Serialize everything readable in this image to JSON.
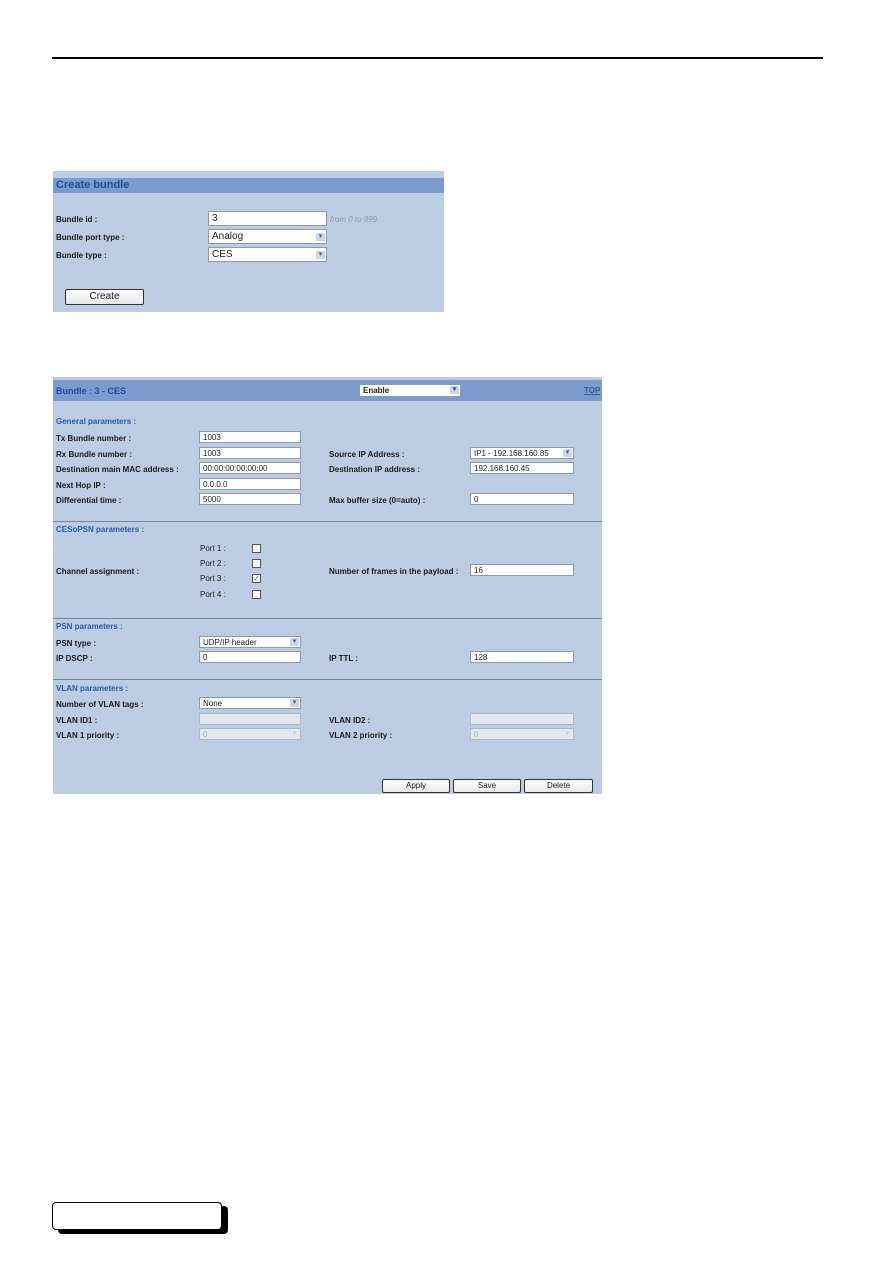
{
  "create_bundle": {
    "title": "Create bundle",
    "fields": {
      "bundle_id_label": "Bundle id :",
      "bundle_id_value": "3",
      "bundle_id_hint": "from 0 to 999",
      "port_type_label": "Bundle port type :",
      "port_type_value": "Analog",
      "bundle_type_label": "Bundle type :",
      "bundle_type_value": "CES"
    },
    "create_button": "Create"
  },
  "bundle": {
    "title": "Bundle : 3 - CES",
    "state_value": "Enable",
    "top_link": "TOP",
    "general": {
      "title": "General parameters :",
      "tx_label": "Tx Bundle number :",
      "tx_value": "1003",
      "rx_label": "Rx Bundle number :",
      "rx_value": "1003",
      "mac_label": "Destination main MAC address :",
      "mac_value": "00:00:00:00:00:00",
      "nexthop_label": "Next Hop IP :",
      "nexthop_value": "0.0.0.0",
      "diff_label": "Differential time :",
      "diff_value": "5000",
      "src_ip_label": "Source IP Address :",
      "src_ip_value": "IP1 - 192.168.160.85",
      "dst_ip_label": "Destination IP address :",
      "dst_ip_value": "192.168.160.45",
      "maxbuf_label": "Max buffer size (0=auto) :",
      "maxbuf_value": "0"
    },
    "cesopsn": {
      "title": "CESoPSN parameters :",
      "channel_label": "Channel assignment :",
      "ports": [
        {
          "label": "Port 1 :",
          "checked": false
        },
        {
          "label": "Port 2 :",
          "checked": false
        },
        {
          "label": "Port 3 :",
          "checked": true
        },
        {
          "label": "Port 4 :",
          "checked": false
        }
      ],
      "frames_label": "Number of frames in the payload :",
      "frames_value": "16"
    },
    "psn": {
      "title": "PSN parameters :",
      "type_label": "PSN type :",
      "type_value": "UDP/IP header",
      "dscp_label": "IP DSCP :",
      "dscp_value": "0",
      "ttl_label": "IP TTL :",
      "ttl_value": "128"
    },
    "vlan": {
      "title": "VLAN parameters :",
      "tags_label": "Number of VLAN tags :",
      "tags_value": "None",
      "id1_label": "VLAN ID1 :",
      "id1_value": "",
      "id2_label": "VLAN ID2 :",
      "id2_value": "",
      "prio1_label": "VLAN 1 priority :",
      "prio1_value": "0",
      "prio2_label": "VLAN 2 priority :",
      "prio2_value": "0"
    },
    "buttons": {
      "apply": "Apply",
      "save": "Save",
      "delete": "Delete"
    }
  },
  "icons": {
    "dropdown": "▾",
    "check": "✓"
  }
}
